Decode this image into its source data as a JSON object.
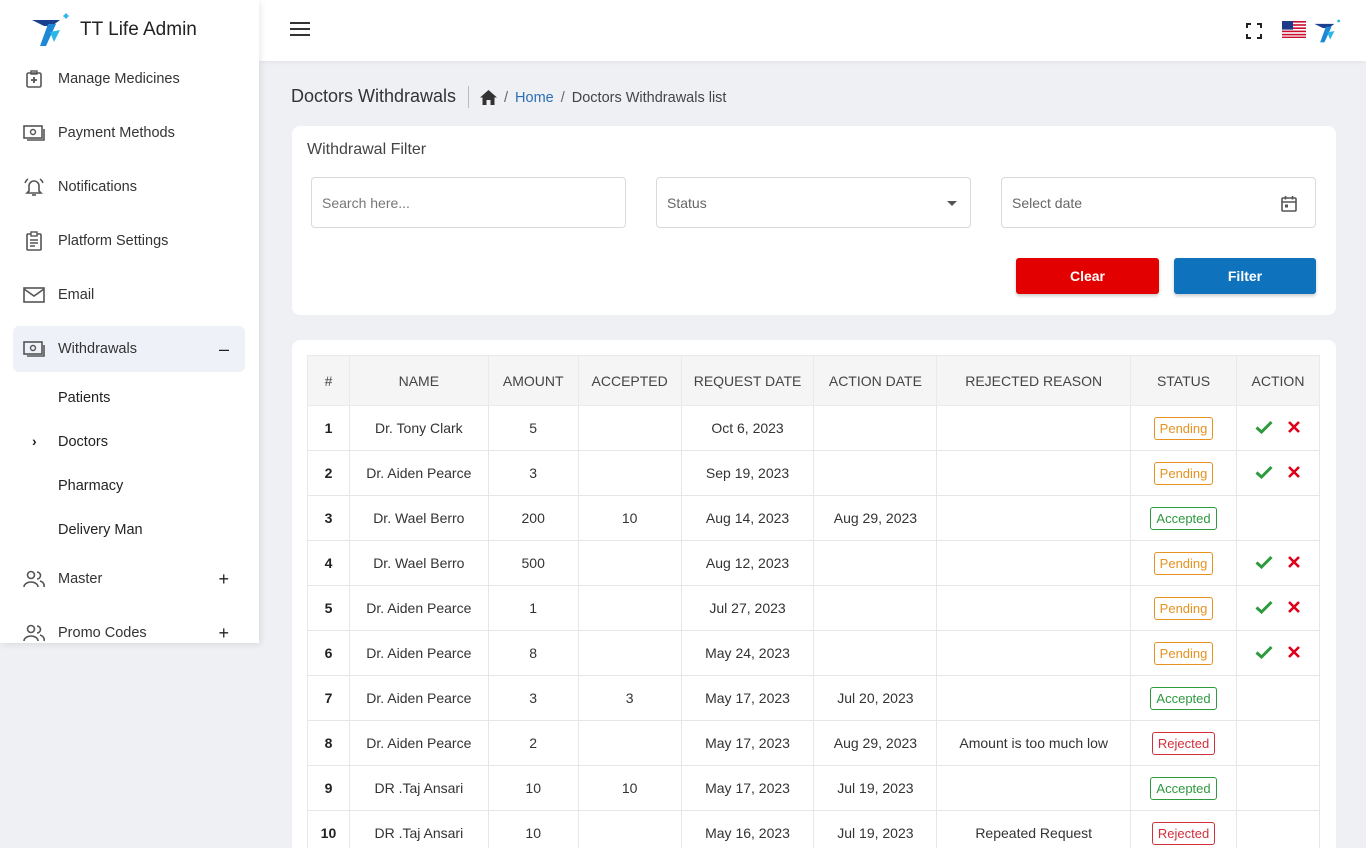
{
  "app": {
    "title": "TT Life Admin"
  },
  "sidebar": {
    "items": [
      {
        "label": "Manage Medicines",
        "icon": "medical-kit-icon"
      },
      {
        "label": "Payment Methods",
        "icon": "money-icon"
      },
      {
        "label": "Notifications",
        "icon": "bell-icon"
      },
      {
        "label": "Platform Settings",
        "icon": "clipboard-icon"
      },
      {
        "label": "Email",
        "icon": "mail-icon"
      },
      {
        "label": "Withdrawals",
        "icon": "money-icon",
        "toggle": "–"
      },
      {
        "label": "Master",
        "icon": "users-icon",
        "toggle": "+"
      },
      {
        "label": "Promo Codes",
        "icon": "users-icon",
        "toggle": "+"
      }
    ],
    "withdrawal_sub": [
      "Patients",
      "Doctors",
      "Pharmacy",
      "Delivery Man"
    ],
    "active_sub_chevron": "›"
  },
  "header": {
    "page_title": "Doctors Withdrawals",
    "breadcrumb_home": "Home",
    "breadcrumb_sep": "/",
    "breadcrumb_current": "Doctors Withdrawals list"
  },
  "filter": {
    "title": "Withdrawal Filter",
    "search_placeholder": "Search here...",
    "status_placeholder": "Status",
    "date_placeholder": "Select date",
    "clear_label": "Clear",
    "filter_label": "Filter"
  },
  "table": {
    "headers": [
      "#",
      "NAME",
      "AMOUNT",
      "ACCEPTED",
      "REQUEST DATE",
      "ACTION DATE",
      "REJECTED REASON",
      "STATUS",
      "ACTION"
    ],
    "rows": [
      {
        "num": "1",
        "name": "Dr. Tony Clark",
        "amount": "5",
        "accepted": "",
        "request_date": "Oct 6, 2023",
        "action_date": "",
        "reason": "",
        "status": "Pending"
      },
      {
        "num": "2",
        "name": "Dr. Aiden Pearce",
        "amount": "3",
        "accepted": "",
        "request_date": "Sep 19, 2023",
        "action_date": "",
        "reason": "",
        "status": "Pending"
      },
      {
        "num": "3",
        "name": "Dr. Wael Berro",
        "amount": "200",
        "accepted": "10",
        "request_date": "Aug 14, 2023",
        "action_date": "Aug 29, 2023",
        "reason": "",
        "status": "Accepted"
      },
      {
        "num": "4",
        "name": "Dr. Wael Berro",
        "amount": "500",
        "accepted": "",
        "request_date": "Aug 12, 2023",
        "action_date": "",
        "reason": "",
        "status": "Pending"
      },
      {
        "num": "5",
        "name": "Dr. Aiden Pearce",
        "amount": "1",
        "accepted": "",
        "request_date": "Jul 27, 2023",
        "action_date": "",
        "reason": "",
        "status": "Pending"
      },
      {
        "num": "6",
        "name": "Dr. Aiden Pearce",
        "amount": "8",
        "accepted": "",
        "request_date": "May 24, 2023",
        "action_date": "",
        "reason": "",
        "status": "Pending"
      },
      {
        "num": "7",
        "name": "Dr. Aiden Pearce",
        "amount": "3",
        "accepted": "3",
        "request_date": "May 17, 2023",
        "action_date": "Jul 20, 2023",
        "reason": "",
        "status": "Accepted"
      },
      {
        "num": "8",
        "name": "Dr. Aiden Pearce",
        "amount": "2",
        "accepted": "",
        "request_date": "May 17, 2023",
        "action_date": "Aug 29, 2023",
        "reason": "Amount is too much low",
        "status": "Rejected"
      },
      {
        "num": "9",
        "name": "DR .Taj Ansari",
        "amount": "10",
        "accepted": "10",
        "request_date": "May 17, 2023",
        "action_date": "Jul 19, 2023",
        "reason": "",
        "status": "Accepted"
      },
      {
        "num": "10",
        "name": "DR .Taj Ansari",
        "amount": "10",
        "accepted": "",
        "request_date": "May 16, 2023",
        "action_date": "Jul 19, 2023",
        "reason": "Repeated Request",
        "status": "Rejected"
      }
    ]
  },
  "colors": {
    "pending": "#e69220",
    "accepted": "#2e9a3e",
    "rejected": "#d32f3a",
    "approve_icon": "#2e9a3e",
    "reject_icon": "#e0001a",
    "clear_button": "#e30000",
    "filter_button": "#0e72bd",
    "link": "#2c6fb5"
  }
}
